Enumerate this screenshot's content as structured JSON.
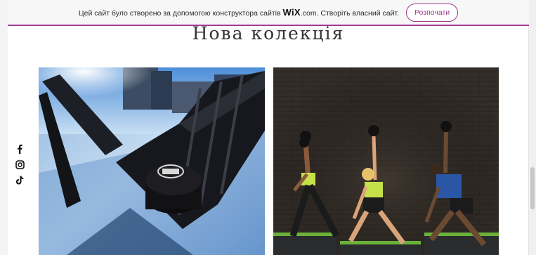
{
  "banner": {
    "text": "Цей сайт було створено за допомогою конструктора сайтів ",
    "logo": "WiX",
    "logo_suffix": ".com. Створіть власний сайт.",
    "button_label": "Розпочати",
    "accent_color": "#a13b94"
  },
  "page": {
    "title": "Нова колекція"
  },
  "social": [
    {
      "name": "facebook-icon"
    },
    {
      "name": "instagram-icon"
    },
    {
      "name": "tiktok-icon"
    }
  ],
  "gallery": [
    {
      "name": "hockey-photo",
      "subject": "hockey stick and puck on ice"
    },
    {
      "name": "fitness-photo",
      "subject": "three athletes exercising with kettlebells"
    }
  ]
}
